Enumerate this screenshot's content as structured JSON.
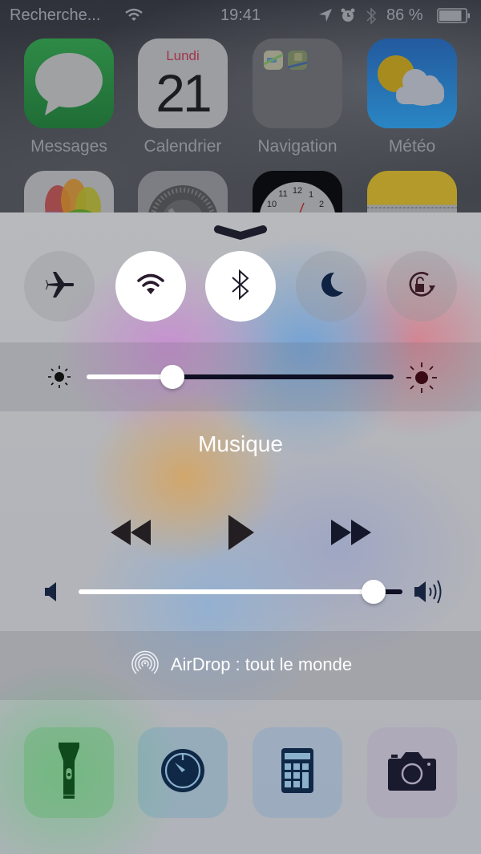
{
  "status_bar": {
    "carrier": "Recherche...",
    "time": "19:41",
    "battery_percent": "86 %",
    "battery_level": 0.86,
    "icons": [
      "wifi-icon",
      "location-icon",
      "alarm-icon",
      "bluetooth-icon",
      "battery-icon"
    ]
  },
  "home_screen": {
    "apps": [
      {
        "name": "Messages",
        "icon": "messages-icon"
      },
      {
        "name": "Calendrier",
        "icon": "calendar-icon",
        "day": "Lundi",
        "date": "21"
      },
      {
        "name": "Navigation",
        "icon": "folder-icon"
      },
      {
        "name": "Météo",
        "icon": "weather-icon"
      },
      {
        "name": "",
        "icon": "photos-icon"
      },
      {
        "name": "",
        "icon": "settings-icon"
      },
      {
        "name": "",
        "icon": "clock-icon"
      },
      {
        "name": "",
        "icon": "notes-icon"
      }
    ]
  },
  "control_center": {
    "handle_icon": "chevron-down-icon",
    "toggles": [
      {
        "id": "airplane",
        "icon": "airplane-icon",
        "on": false
      },
      {
        "id": "wifi",
        "icon": "wifi-icon",
        "on": true
      },
      {
        "id": "bluetooth",
        "icon": "bluetooth-icon",
        "on": true
      },
      {
        "id": "do-not-disturb",
        "icon": "moon-icon",
        "on": false
      },
      {
        "id": "rotation-lock",
        "icon": "rotation-lock-icon",
        "on": false
      }
    ],
    "brightness": {
      "value": 0.28,
      "min_icon": "sun-small-icon",
      "max_icon": "sun-large-icon"
    },
    "music": {
      "title": "Musique",
      "controls": [
        "rewind-icon",
        "play-icon",
        "fast-forward-icon"
      ]
    },
    "volume": {
      "value": 0.91,
      "min_icon": "speaker-low-icon",
      "max_icon": "speaker-high-icon"
    },
    "airdrop": {
      "label": "AirDrop : tout le monde",
      "icon": "airdrop-icon"
    },
    "shortcuts": [
      {
        "id": "flashlight",
        "icon": "flashlight-icon",
        "color": "#0f4a1c"
      },
      {
        "id": "timer",
        "icon": "timer-icon",
        "color": "#0f2846"
      },
      {
        "id": "calculator",
        "icon": "calculator-icon",
        "color": "#0f2846"
      },
      {
        "id": "camera",
        "icon": "camera-icon",
        "color": "#1a1a2e"
      }
    ]
  },
  "colors": {
    "icon_dark": "#1a1c2c",
    "slider_min_track": "#ffffff",
    "slider_max_track": "#0e0f22"
  }
}
